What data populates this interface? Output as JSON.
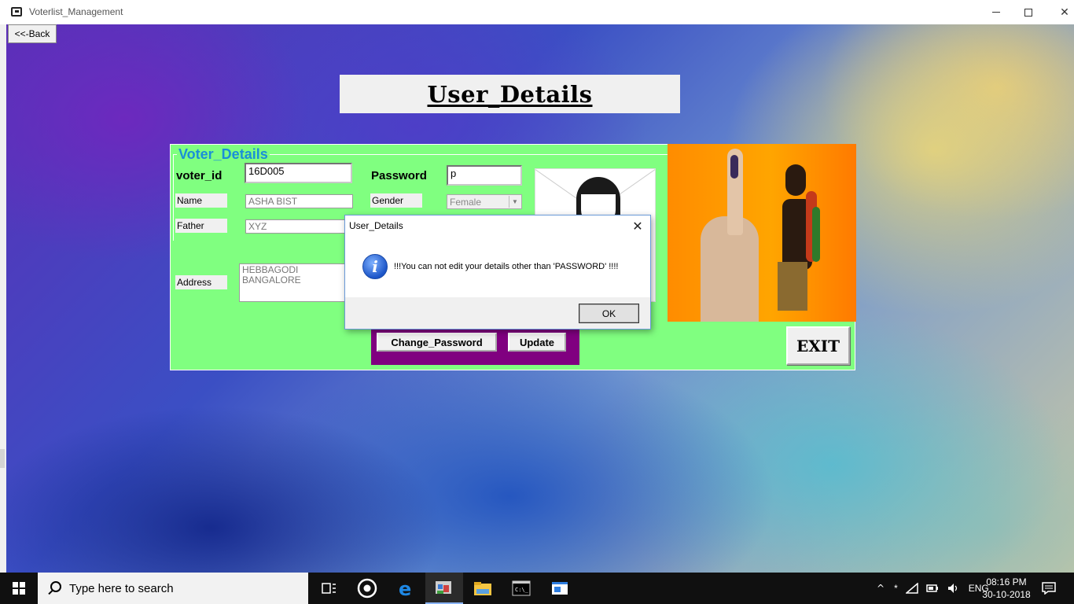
{
  "window": {
    "title": "Voterlist_Management",
    "minimize_glyph": "",
    "close_glyph": "✕"
  },
  "back_button": "<<-Back",
  "heading": "User_Details",
  "frame": {
    "legend": "Voter_Details",
    "voter_id_label": "voter_id",
    "voter_id_value": "16D005",
    "password_label": "Password",
    "password_value": "p",
    "name_label": "Name",
    "name_value": "ASHA BIST",
    "gender_label": "Gender",
    "gender_value": "Female",
    "father_label": "Father",
    "father_value": "XYZ",
    "address_label": "Address",
    "address_line1": "HEBBAGODI",
    "address_line2": "BANGALORE"
  },
  "buttons": {
    "change_password": "Change_Password",
    "update": "Update",
    "exit": "EXIT"
  },
  "dialog": {
    "title": "User_Details",
    "message": "!!!You can not edit your details other than 'PASSWORD' !!!!",
    "ok": "OK",
    "close_glyph": "✕",
    "icon_glyph": "i"
  },
  "taskbar": {
    "search_placeholder": "Type here to search",
    "language": "ENG",
    "time": "08:16 PM",
    "date": "30-10-2018"
  },
  "icons": [
    "app-icon",
    "windows-start-icon",
    "search-icon",
    "task-view-icon",
    "chrome-icon",
    "edge-icon",
    "vb-app-icon",
    "file-explorer-icon",
    "cmd-icon",
    "app-window-icon",
    "chevron-up-icon",
    "bluetooth-icon",
    "network-icon",
    "battery-icon",
    "volume-icon",
    "notification-icon",
    "info-icon"
  ],
  "colors": {
    "panel_green": "#80ff80",
    "legend_blue": "#1a8fd8",
    "purple_bar": "#800080",
    "taskbar": "#101010"
  }
}
